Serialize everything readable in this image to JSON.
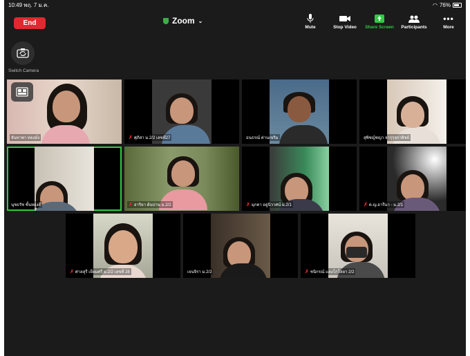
{
  "status_bar": {
    "time": "10:49",
    "date": "พฤ. 7 ม.ค.",
    "battery": "76%"
  },
  "header": {
    "end_label": "End",
    "title": "Zoom",
    "toolbar": [
      {
        "label": "Mute",
        "icon": "microphone-icon"
      },
      {
        "label": "Stop Video",
        "icon": "video-camera-icon"
      },
      {
        "label": "Share Screen",
        "icon": "share-screen-icon",
        "accent": "#2ecc40"
      },
      {
        "label": "Participants",
        "icon": "participants-icon"
      },
      {
        "label": "More",
        "icon": "more-dots-icon"
      }
    ],
    "switch_camera_label": "Switch Camera"
  },
  "colors": {
    "end": "#e0292f",
    "accent": "#2ecc40",
    "background": "#1b1b1b"
  },
  "participants": [
    {
      "name": "จันทาพา ทองมั่ง",
      "muted": false,
      "active": false
    },
    {
      "name": "ศุภิสา ม.2/2 เลขที่27",
      "muted": true,
      "active": false
    },
    {
      "name": "ธนธรณ์ ด่านเขริม",
      "muted": false,
      "active": false
    },
    {
      "name": "สุพิชญ์ชญา จารุรุจกายิชย์",
      "muted": false,
      "active": false
    },
    {
      "name": "นุชธรัช ชั้นทองดี",
      "muted": false,
      "active": true
    },
    {
      "name": "อาริยา ต้นปาน ม.2/2",
      "muted": true,
      "active": false
    },
    {
      "name": "มุกดา อยู่นิวาศน์ ม.2/1",
      "muted": true,
      "active": false
    },
    {
      "name": "ด.ญ.อารีนา - ม.2/1",
      "muted": true,
      "active": false
    },
    {
      "name": "ศาลสุรี เยี่ยมศรี ม.2/2 เลขที่ 28",
      "muted": true,
      "active": false
    },
    {
      "name": "เจนจิรา ม.2/2",
      "muted": false,
      "active": false
    },
    {
      "name": "ชนิกรณ์ แตงโกโลยา 2/2",
      "muted": true,
      "active": false
    }
  ]
}
